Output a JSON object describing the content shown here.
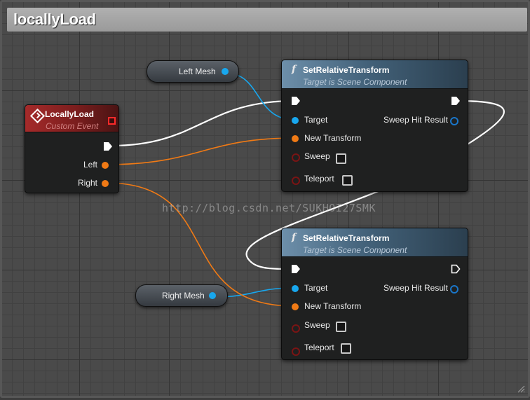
{
  "comment": {
    "title": "locallyLoad"
  },
  "nodes": {
    "event": {
      "title": "LocallyLoad",
      "subtitle": "Custom Event",
      "pins": {
        "left": "Left",
        "right": "Right"
      }
    },
    "set_top": {
      "title": "SetRelativeTransform",
      "subtitle": "Target is Scene Component",
      "pins": {
        "target": "Target",
        "new_transform": "New Transform",
        "sweep": "Sweep",
        "teleport": "Teleport",
        "sweep_hit_result": "Sweep Hit Result"
      }
    },
    "set_bottom": {
      "title": "SetRelativeTransform",
      "subtitle": "Target is Scene Component",
      "pins": {
        "target": "Target",
        "new_transform": "New Transform",
        "sweep": "Sweep",
        "teleport": "Teleport",
        "sweep_hit_result": "Sweep Hit Result"
      }
    },
    "left_mesh": {
      "label": "Left Mesh"
    },
    "right_mesh": {
      "label": "Right Mesh"
    }
  },
  "watermark": "http://blog.csdn.net/SUKHOI27SMK",
  "colors": {
    "exec_wire": "#ffffff",
    "object_pin": "#18a7ee",
    "transform_pin": "#f07a15",
    "event_header": "#a52a2a",
    "function_header": "#43627a",
    "bool_pin": "#7a1414"
  },
  "icons": [
    "function-icon",
    "event-icon",
    "exec-pin-icon",
    "checkbox-icon",
    "resize-handle-icon"
  ]
}
